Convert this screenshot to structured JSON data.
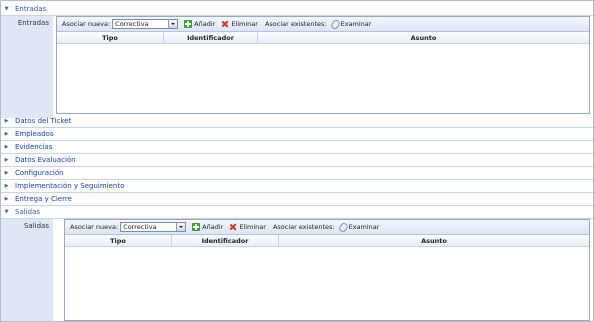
{
  "sections": [
    {
      "title": "Entradas",
      "expanded": true
    },
    {
      "title": "Datos del Ticket",
      "expanded": false
    },
    {
      "title": "Empleados",
      "expanded": false
    },
    {
      "title": "Evidencias",
      "expanded": false
    },
    {
      "title": "Datos Evaluación",
      "expanded": false
    },
    {
      "title": "Configuración",
      "expanded": false
    },
    {
      "title": "Implementación y Seguimiento",
      "expanded": false
    },
    {
      "title": "Entrega y Cierre",
      "expanded": false
    },
    {
      "title": "Salidas",
      "expanded": true
    }
  ],
  "entradas": {
    "field_label": "Entradas",
    "toolbar": {
      "associate_new_label": "Asociar nueva:",
      "select_value": "Correctiva",
      "add_label": "Añadir",
      "delete_label": "Eliminar",
      "associate_existing_label": "Asociar existentes:",
      "browse_label": "Examinar"
    },
    "columns": [
      "Tipo",
      "Identificador",
      "Asunto"
    ],
    "rows": []
  },
  "salidas": {
    "field_label": "Salidas",
    "toolbar": {
      "associate_new_label": "Asociar nueva:",
      "select_value": "Correctiva",
      "add_label": "Añadir",
      "delete_label": "Eliminar",
      "associate_existing_label": "Asociar existentes:",
      "browse_label": "Examinar"
    },
    "columns": [
      "Tipo",
      "Identificador",
      "Asunto"
    ],
    "rows": []
  },
  "icons": {
    "expanded": "triangle-down",
    "collapsed": "triangle-right",
    "add": "plus-icon",
    "delete": "x-icon",
    "browse": "paperclip-icon"
  },
  "colors": {
    "accent_link": "#1a3eb8",
    "label_column_bg": "#dfe6f5",
    "delete_red": "#d0392b",
    "add_green": "#3aa02f"
  }
}
